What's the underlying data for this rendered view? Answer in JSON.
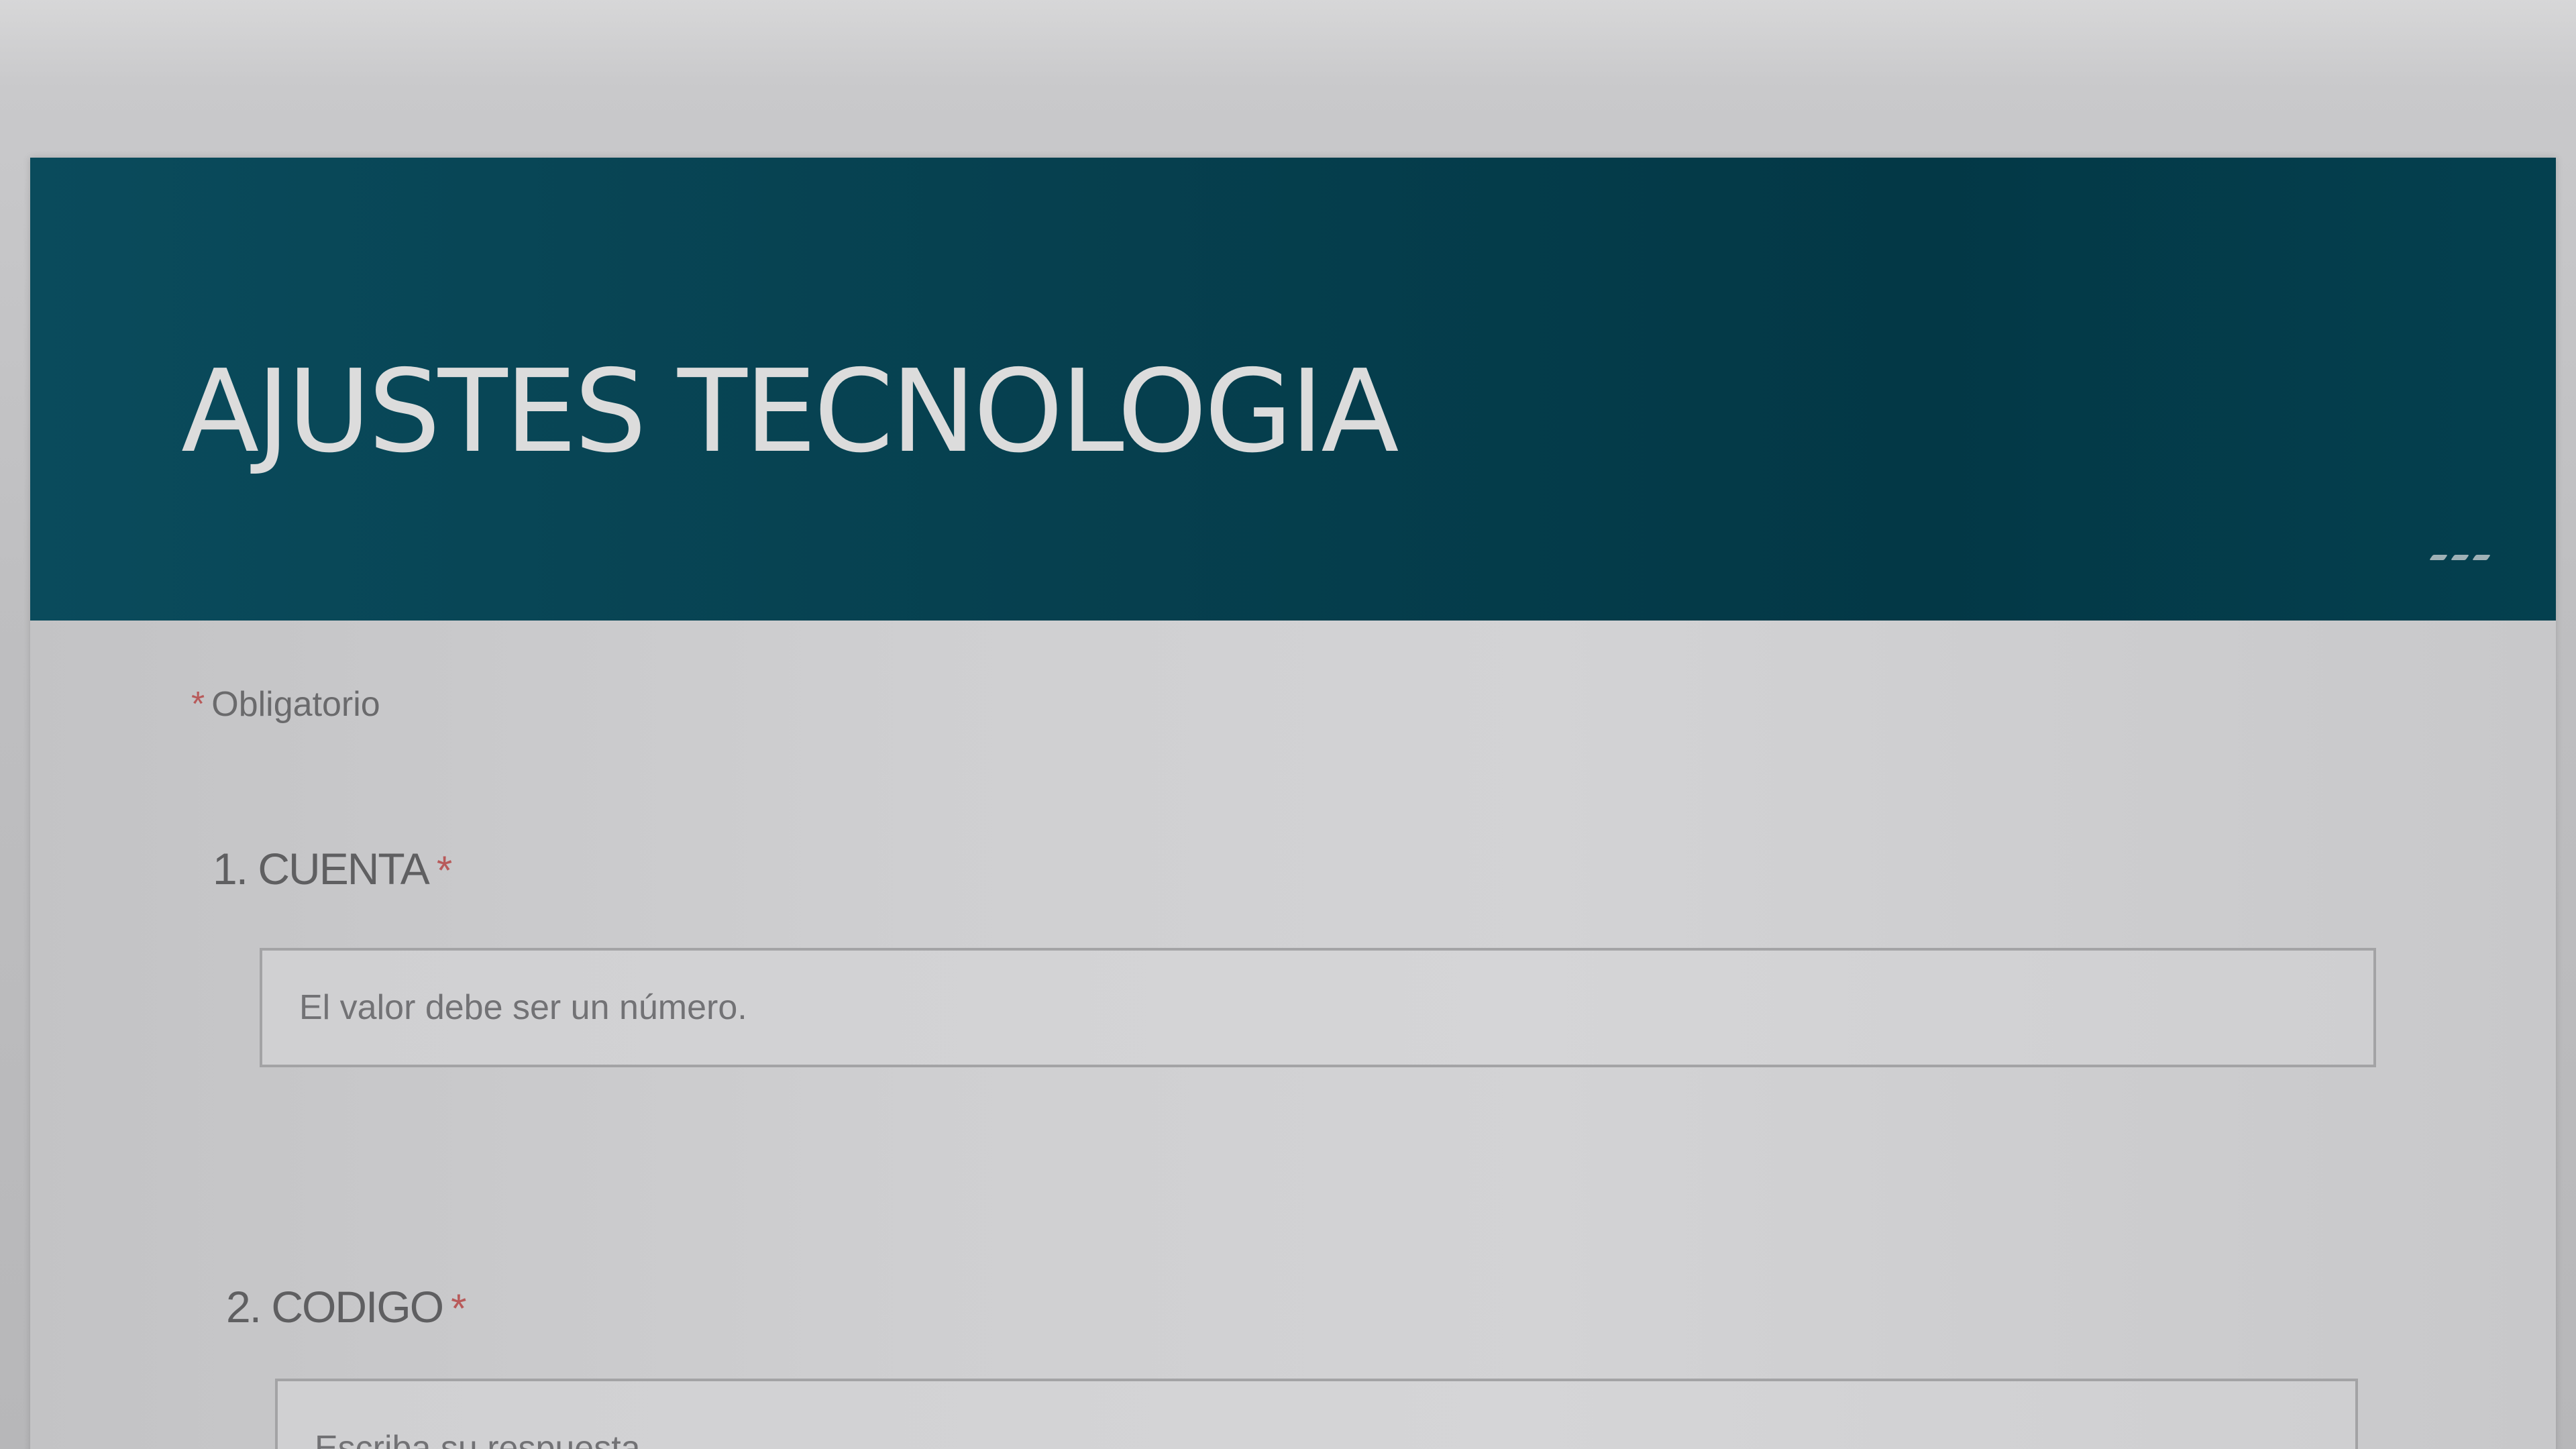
{
  "form": {
    "title": "AJUSTES TECNOLOGIA",
    "more_icon": "more-dots-icon",
    "required_marker": "*",
    "required_note": "Obligatorio",
    "colors": {
      "banner": "#044252",
      "title_text": "#dcdcdc",
      "required_asterisk": "#b85a5a",
      "card_background": "#d2d2d4"
    }
  },
  "questions": [
    {
      "label": "1. CUENTA",
      "required_marker": "*",
      "placeholder": "El valor debe ser un número."
    },
    {
      "label": "2. CODIGO",
      "required_marker": "*",
      "placeholder": "Escriba su respuesta"
    }
  ]
}
